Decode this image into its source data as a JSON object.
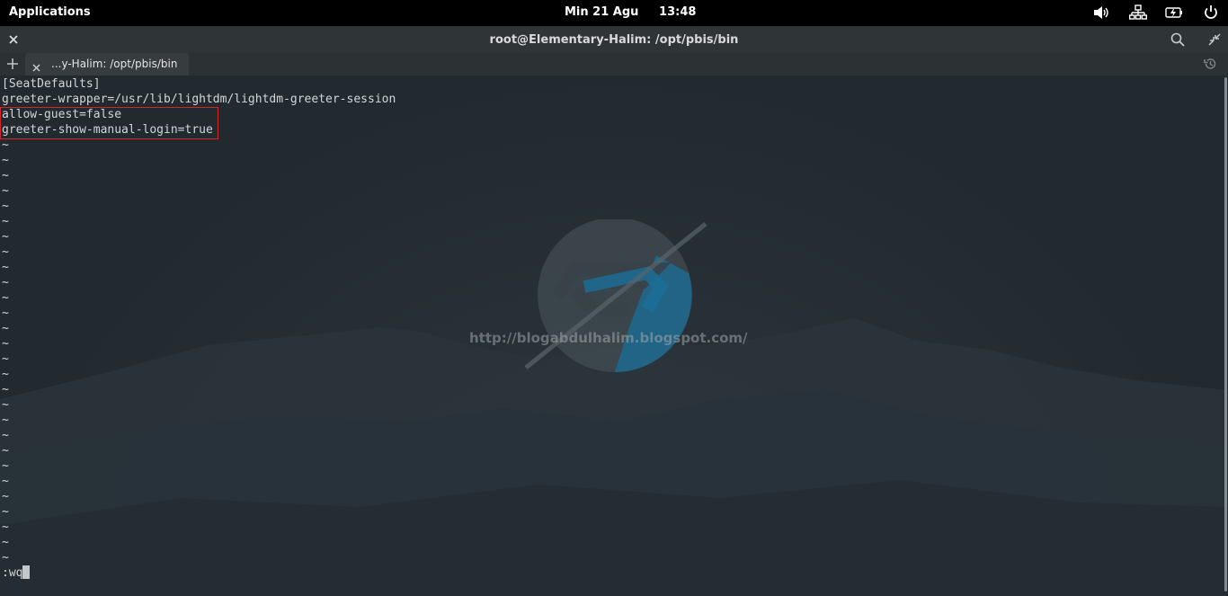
{
  "panel": {
    "applications_label": "Applications",
    "datetime": "Min 21 Agu     13:48",
    "indicators": [
      "volume-icon",
      "network-icon",
      "battery-icon",
      "power-icon"
    ]
  },
  "window": {
    "title": "root@Elementary-Halim: /opt/pbis/bin",
    "buttons": [
      "close-icon",
      "search-icon",
      "restore-icon"
    ]
  },
  "tabs": [
    {
      "label": "...y-Halim: /opt/pbis/bin"
    }
  ],
  "terminal": {
    "lines": [
      "[SeatDefaults]",
      "greeter-wrapper=/usr/lib/lightdm/lightdm-greeter-session",
      "allow-guest=false",
      "greeter-show-manual-login=true"
    ],
    "empty_marker": "~",
    "command": ":wq"
  },
  "watermark": {
    "url": "http://blogabdulhalim.blogspot.com/"
  },
  "colors": {
    "background": "#22282d",
    "tilde": "#3a8fd6",
    "highlight_box": "#d2262a",
    "logo_blue": "#1b6f98"
  }
}
